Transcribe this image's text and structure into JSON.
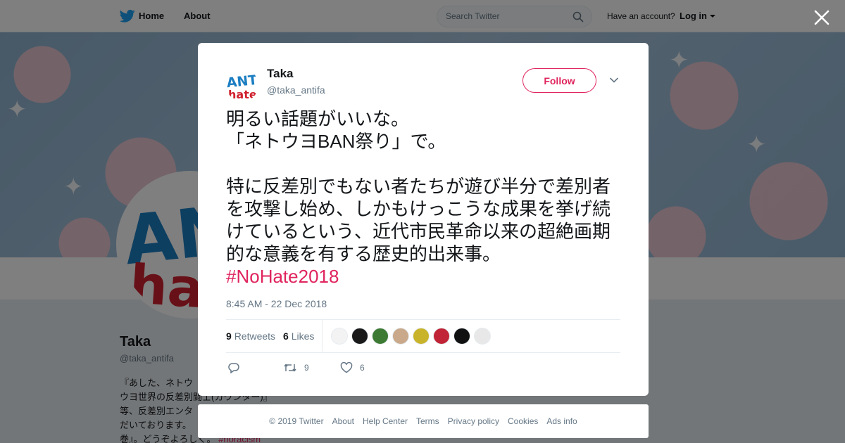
{
  "nav": {
    "home_label": "Home",
    "about_label": "About",
    "search_placeholder": "Search Twitter",
    "have_account": "Have an account?",
    "login_label": "Log in"
  },
  "profile": {
    "name": "Taka",
    "handle": "@taka_antifa",
    "bio": "『あした、ネトウ\nウヨ世界の反差別闘士(カウンター)』\n等、反差別エンタ\nだいております。\n巻』。どうぞよろしく。",
    "bio_hashtag": "#noracism"
  },
  "tweet": {
    "author_name": "Taka",
    "author_handle": "@taka_antifa",
    "follow_label": "Follow",
    "text": "明るい話題がいいな。\n「ネトウヨBAN祭り」で。\n\n特に反差別でもない者たちが遊び半分で差別者を攻撃し始め、しかもけっこうな成果を挙げ続けているという、近代市民革命以来の超絶画期的な意義を有する歴史的出来事。\n",
    "hashtag": "#NoHate2018",
    "timestamp": "8:45 AM - 22 Dec 2018",
    "retweets_count": "9",
    "retweets_label": "Retweets",
    "likes_count": "6",
    "likes_label": "Likes",
    "action_retweet_count": "9",
    "action_like_count": "6"
  },
  "footer": {
    "links": [
      "© 2019 Twitter",
      "About",
      "Help Center",
      "Terms",
      "Privacy policy",
      "Cookies",
      "Ads info"
    ]
  },
  "colors": {
    "accent": "#e0245e",
    "twitter_blue": "#1da1f2",
    "secondary_text": "#657786"
  },
  "icons": {
    "logo": "twitter-bird-icon",
    "search": "search-icon",
    "close": "close-icon",
    "menu": "chevron-down-icon",
    "reply": "reply-icon",
    "retweet": "retweet-icon",
    "like": "heart-icon"
  }
}
